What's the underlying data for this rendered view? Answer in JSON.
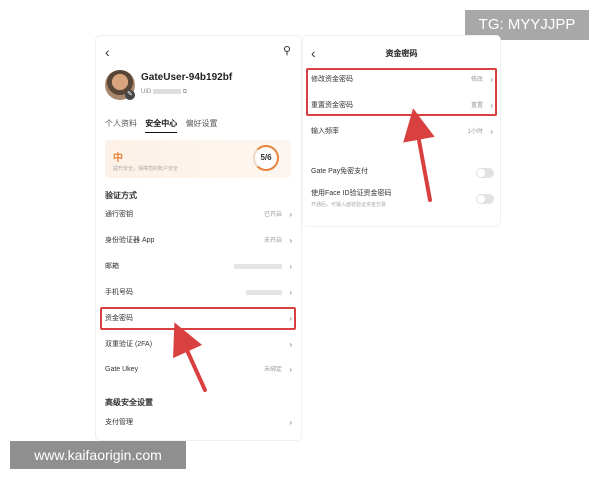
{
  "watermarks": {
    "telegram": "TG: MYYJJPP",
    "site": "www.kaifaorigin.com"
  },
  "left": {
    "username": "GateUser-94b192bf",
    "uid_label": "UID",
    "tabs": [
      {
        "label": "个人资料",
        "active": false
      },
      {
        "label": "安全中心",
        "active": true
      },
      {
        "label": "偏好设置",
        "active": false
      }
    ],
    "security": {
      "level": "中",
      "description": "提升安全，保障您的账户安全",
      "score": "5/6"
    },
    "verification_title": "验证方式",
    "items": [
      {
        "label": "通行密钥",
        "value": "已开启"
      },
      {
        "label": "身份验证器 App",
        "value": "未开启"
      },
      {
        "label": "邮箱",
        "value": ""
      },
      {
        "label": "手机号码",
        "value": ""
      },
      {
        "label": "资金密码",
        "value": ""
      },
      {
        "label": "双重验证 (2FA)",
        "value": ""
      },
      {
        "label": "Gate Ukey",
        "value": "未绑定"
      }
    ],
    "advanced_title": "高级安全设置",
    "advanced_items": [
      {
        "label": "支付管理",
        "value": ""
      }
    ]
  },
  "right": {
    "title": "资金密码",
    "rows": [
      {
        "label": "修改资金密码",
        "value": "修改"
      },
      {
        "label": "重置资金密码",
        "value": "重置"
      },
      {
        "label": "输入频率",
        "value": "1小时"
      }
    ],
    "toggles": [
      {
        "label": "Gate Pay免密支付",
        "desc": ""
      },
      {
        "label": "使用Face ID验证资金密码",
        "desc": "开通后，可输入面容验证资金交易"
      }
    ]
  },
  "colors": {
    "highlight": "#d94040",
    "accent": "#e8823b"
  }
}
